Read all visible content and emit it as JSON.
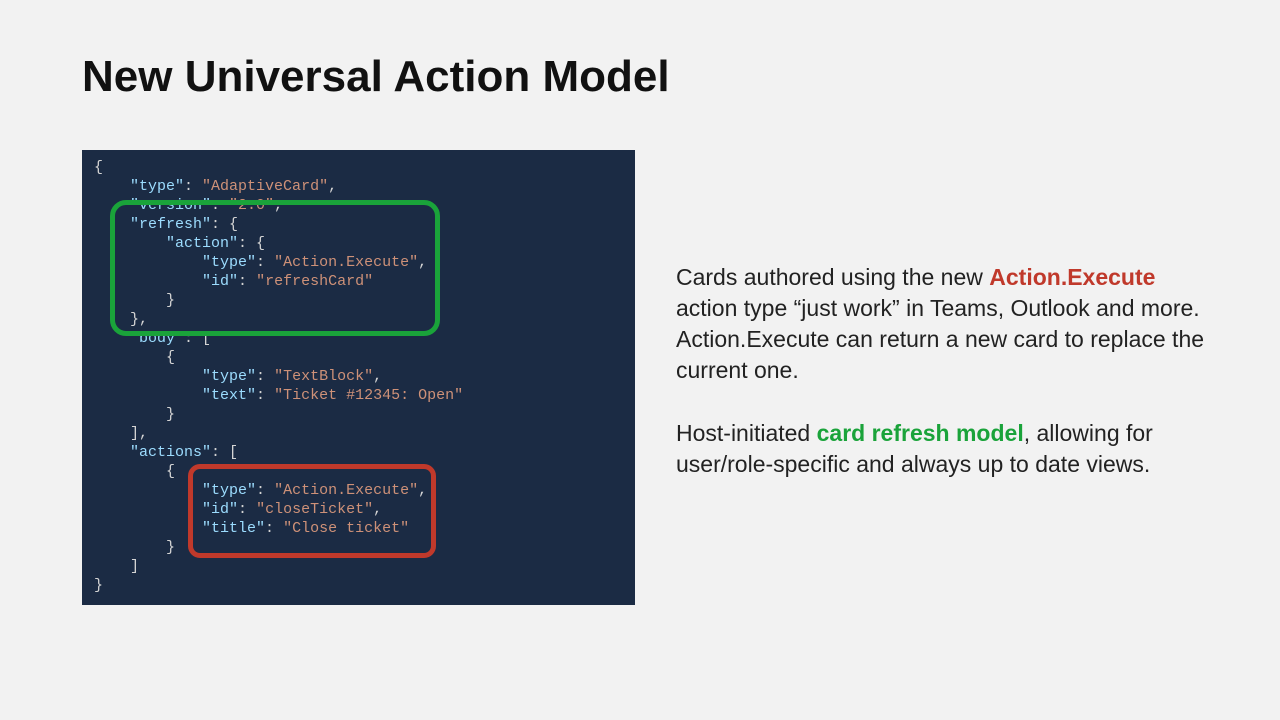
{
  "title": "New Universal Action Model",
  "code": {
    "l01a": "{",
    "l02a": "    ",
    "l02b": "\"type\"",
    "l02c": ": ",
    "l02d": "\"AdaptiveCard\"",
    "l02e": ",",
    "l03a": "    ",
    "l03b": "\"version\"",
    "l03c": ": ",
    "l03d": "\"2.0\"",
    "l03e": ",",
    "l04a": "    ",
    "l04b": "\"refresh\"",
    "l04c": ": {",
    "l05a": "        ",
    "l05b": "\"action\"",
    "l05c": ": {",
    "l06a": "            ",
    "l06b": "\"type\"",
    "l06c": ": ",
    "l06d": "\"Action.Execute\"",
    "l06e": ",",
    "l07a": "            ",
    "l07b": "\"id\"",
    "l07c": ": ",
    "l07d": "\"refreshCard\"",
    "l08a": "        }",
    "l09a": "    },",
    "l10a": "    ",
    "l10b": "\"body\"",
    "l10c": ": [",
    "l11a": "        {",
    "l12a": "            ",
    "l12b": "\"type\"",
    "l12c": ": ",
    "l12d": "\"TextBlock\"",
    "l12e": ",",
    "l13a": "            ",
    "l13b": "\"text\"",
    "l13c": ": ",
    "l13d": "\"Ticket #12345: Open\"",
    "l14a": "        }",
    "l15a": "    ],",
    "l16a": "    ",
    "l16b": "\"actions\"",
    "l16c": ": [",
    "l17a": "        {",
    "l18a": "            ",
    "l18b": "\"type\"",
    "l18c": ": ",
    "l18d": "\"Action.Execute\"",
    "l18e": ",",
    "l19a": "            ",
    "l19b": "\"id\"",
    "l19c": ": ",
    "l19d": "\"closeTicket\"",
    "l19e": ",",
    "l20a": "            ",
    "l20b": "\"title\"",
    "l20c": ": ",
    "l20d": "\"Close ticket\"",
    "l21a": "        }",
    "l22a": "    ]",
    "l23a": "}"
  },
  "para1": {
    "t1": "Cards authored using the new ",
    "t2": "Action.Execute",
    "t3": " action type “just work” in Teams, Outlook and more. Action.Execute can return a new card to replace the current one."
  },
  "para2": {
    "t1": "Host-initiated ",
    "t2": "card refresh model",
    "t3": ", allowing for user/role-specific and always up to date views."
  }
}
